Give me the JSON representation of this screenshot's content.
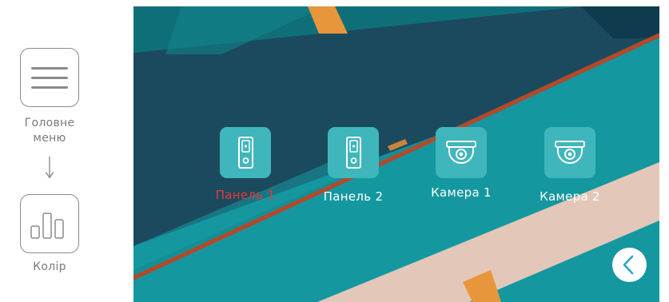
{
  "left_panel": {
    "steps": [
      {
        "label": "Головне\nменю",
        "icon": "menu-icon"
      },
      {
        "label": "Колір",
        "icon": "color-bars-icon"
      }
    ],
    "arrow_icon": "arrow-down-icon"
  },
  "screen": {
    "devices": [
      {
        "label": "Панель 1",
        "icon": "door-panel-icon",
        "selected": true
      },
      {
        "label": "Панель 2",
        "icon": "door-panel-icon",
        "selected": false
      },
      {
        "label": "Камера 1",
        "icon": "dome-camera-icon",
        "selected": false
      },
      {
        "label": "Камера 2",
        "icon": "dome-camera-icon",
        "selected": false
      }
    ],
    "back_icon": "chevron-left-icon"
  },
  "colors": {
    "tile": "#3fb6bc",
    "selected_label": "#e8383a",
    "label": "#ffffff",
    "back_arrow": "#2aa6c7",
    "guide_gray": "#8a8a8a"
  }
}
